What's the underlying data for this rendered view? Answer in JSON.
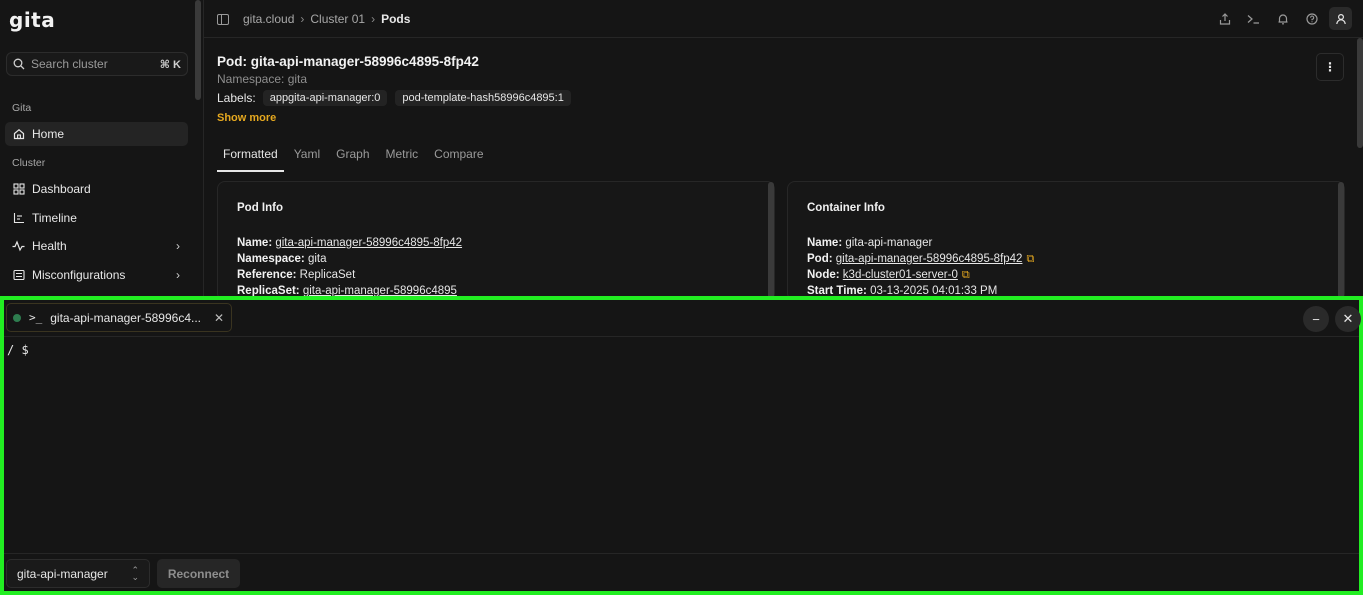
{
  "app": {
    "logo": "gita"
  },
  "sidebar": {
    "search_placeholder": "Search cluster",
    "search_shortcut": "⌘ K",
    "section_gita": "Gita",
    "section_cluster": "Cluster",
    "items": [
      {
        "label": "Home",
        "icon": "home-icon",
        "active": true
      },
      {
        "label": "Dashboard",
        "icon": "grid-icon"
      },
      {
        "label": "Timeline",
        "icon": "chart-icon"
      },
      {
        "label": "Health",
        "icon": "activity-icon",
        "expandable": true
      },
      {
        "label": "Misconfigurations",
        "icon": "list-icon",
        "expandable": true
      }
    ]
  },
  "header": {
    "breadcrumbs": [
      "gita.cloud",
      "Cluster 01",
      "Pods"
    ]
  },
  "pod": {
    "title": "Pod: gita-api-manager-58996c4895-8fp42",
    "namespace": "Namespace: gita",
    "labels_label": "Labels:",
    "labels": [
      "appgita-api-manager:0",
      "pod-template-hash58996c4895:1"
    ],
    "show_more": "Show more"
  },
  "tabs": [
    "Formatted",
    "Yaml",
    "Graph",
    "Metric",
    "Compare"
  ],
  "pod_info": {
    "title": "Pod Info",
    "name_label": "Name:",
    "name": "gita-api-manager-58996c4895-8fp42",
    "namespace_label": "Namespace:",
    "namespace": "gita",
    "reference_label": "Reference:",
    "reference": "ReplicaSet",
    "replicaset_label": "ReplicaSet:",
    "replicaset": "gita-api-manager-58996c4895"
  },
  "container_info": {
    "title": "Container Info",
    "name_label": "Name:",
    "name": "gita-api-manager",
    "pod_label": "Pod:",
    "pod": "gita-api-manager-58996c4895-8fp42",
    "node_label": "Node:",
    "node": "k3d-cluster01-server-0",
    "start_label": "Start Time:",
    "start": "03-13-2025 04:01:33 PM"
  },
  "terminal": {
    "tab_label": "gita-api-manager-58996c4...",
    "prompt": "/ $",
    "container": "gita-api-manager",
    "reconnect": "Reconnect"
  },
  "colors": {
    "accent": "#e5a81f",
    "highlight_border": "#22ee22",
    "status_dot": "#2e7d4f"
  }
}
